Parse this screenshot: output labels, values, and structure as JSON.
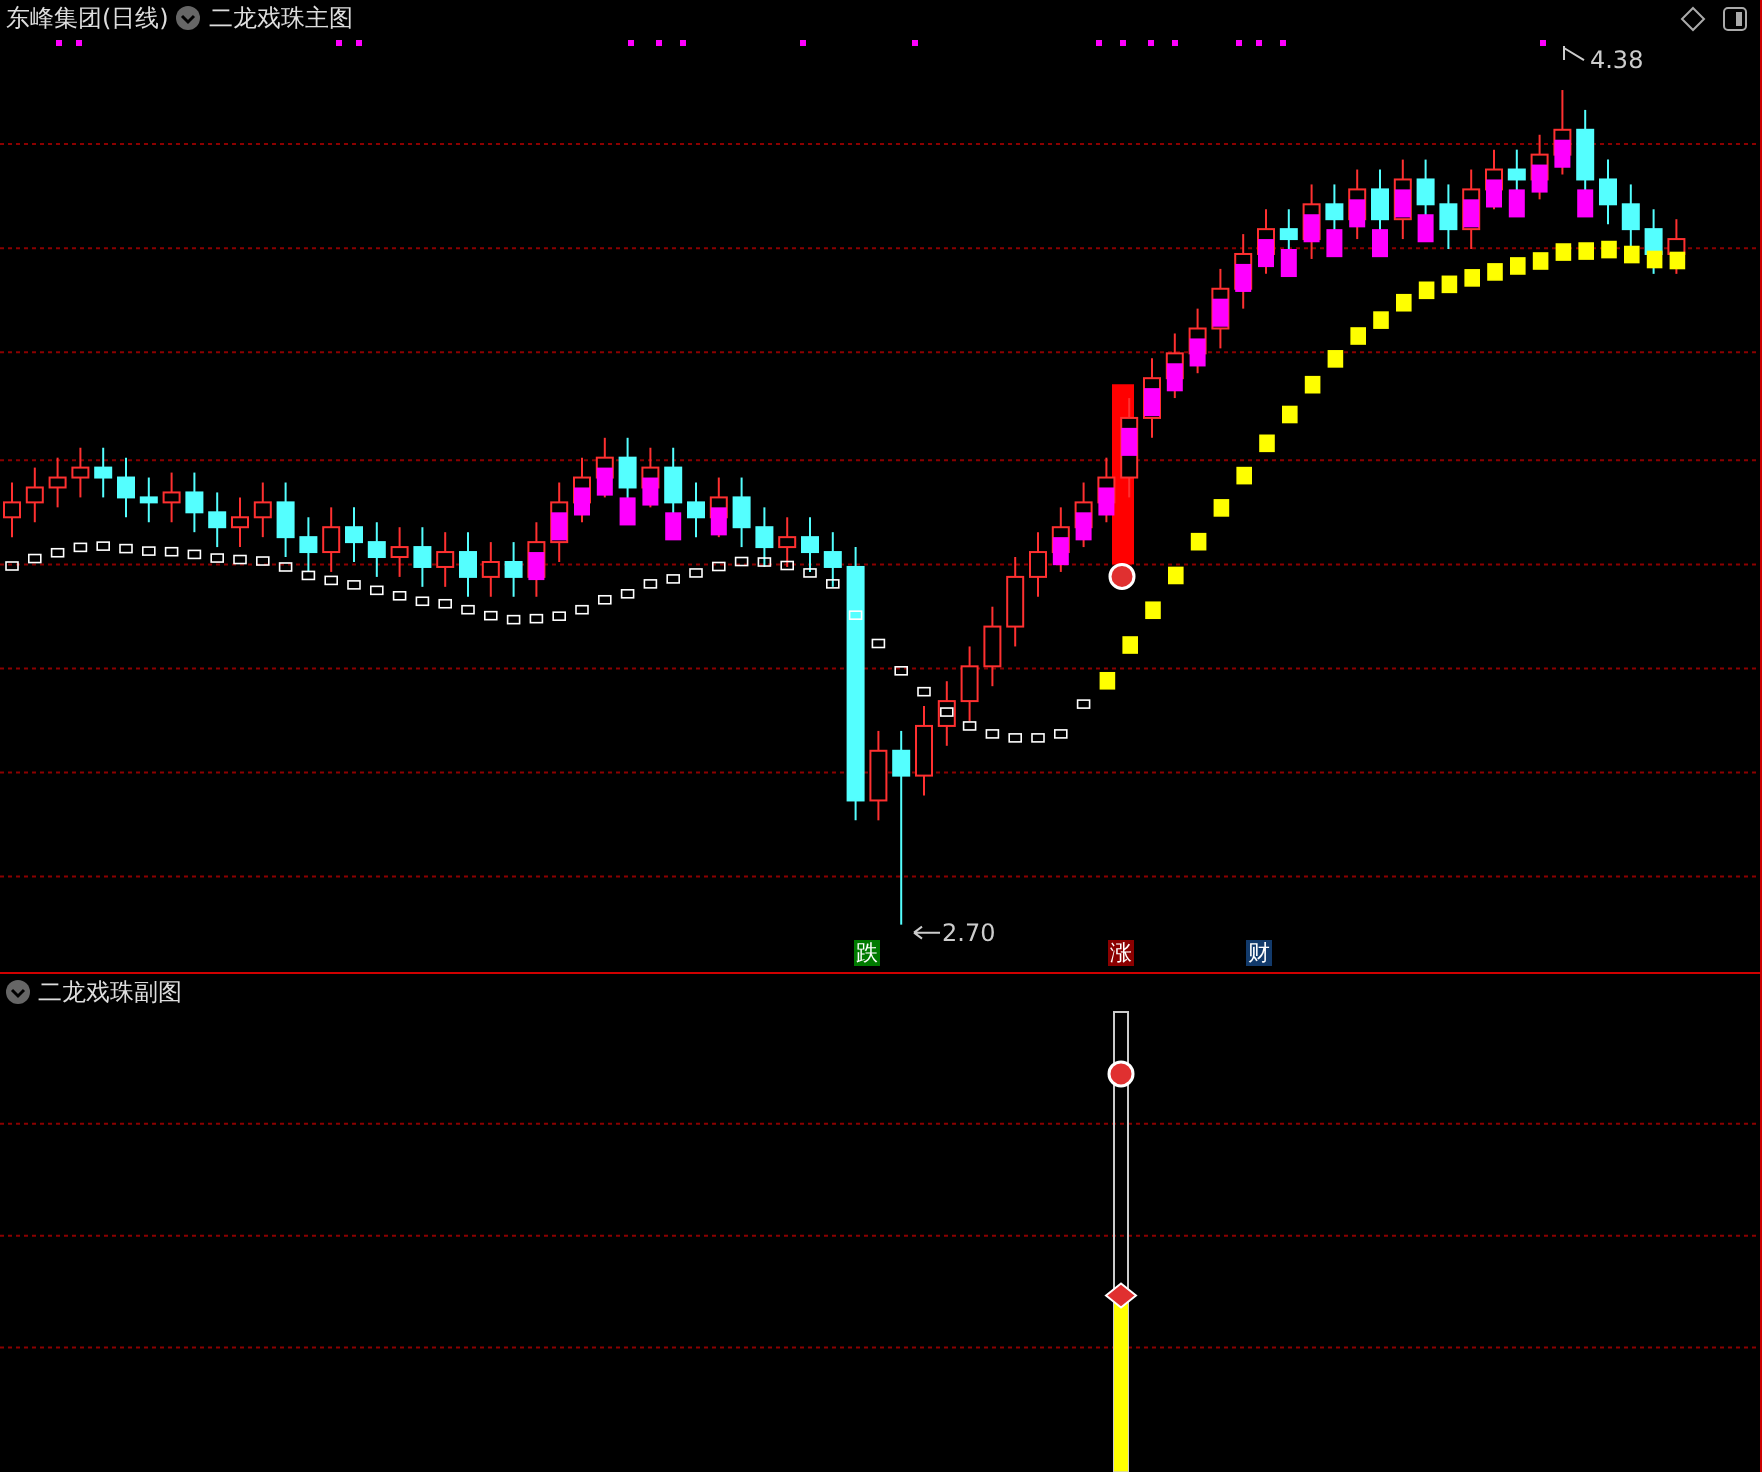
{
  "main_panel": {
    "stock": "东峰集团(日线)",
    "indicator": "二龙戏珠主图",
    "high_label": "4.38",
    "low_label": "2.70",
    "signals": [
      {
        "label": "跌",
        "kind": "down"
      },
      {
        "label": "涨",
        "kind": "up"
      },
      {
        "label": "财",
        "kind": "wealth"
      }
    ]
  },
  "sub_panel": {
    "indicator": "二龙戏珠副图"
  }
}
